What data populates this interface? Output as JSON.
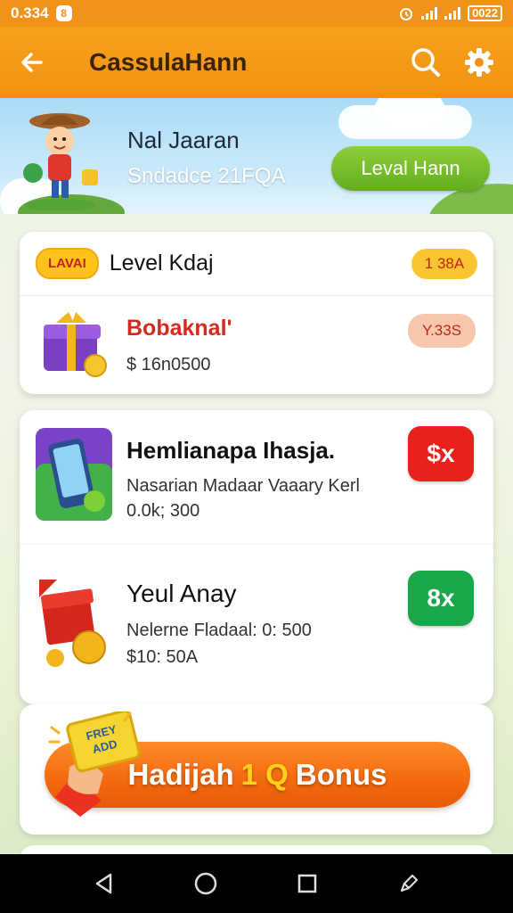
{
  "status_bar": {
    "time": "0.334",
    "badge": "8",
    "battery": "0022"
  },
  "app_bar": {
    "title": "CassulaHann"
  },
  "profile": {
    "name": "Nal Jaaran",
    "subtitle": "Sndadce 21FQA",
    "level_button": "Leval Hann"
  },
  "level_card": {
    "tag": "LAVAI",
    "title": "Level Kdaj",
    "count": "1 38A",
    "item": {
      "title": "Bobaknal'",
      "subtitle": "$ 16n0500",
      "badge": "Y.33S"
    }
  },
  "offers": [
    {
      "title": "Hemlianapa Ihasja.",
      "line1": "Nasarian Madaar Vaaary Kerl",
      "line2": "0.0k; 300",
      "button": "$x",
      "button_color": "#e8211c"
    },
    {
      "title": "Yeul Anay",
      "line1": "Nelerne Fladaal: 0: 500",
      "line2": "$10: 50A",
      "button": "8x",
      "button_color": "#18a84a"
    }
  ],
  "bonus": {
    "sticker": "FREY ADD",
    "label_left": "Hadijah",
    "label_num": "1 Q",
    "label_right": "Bonus"
  },
  "colors": {
    "primary": "#f39212",
    "accent_green": "#62ae1f",
    "bonus": "#f46c10"
  }
}
